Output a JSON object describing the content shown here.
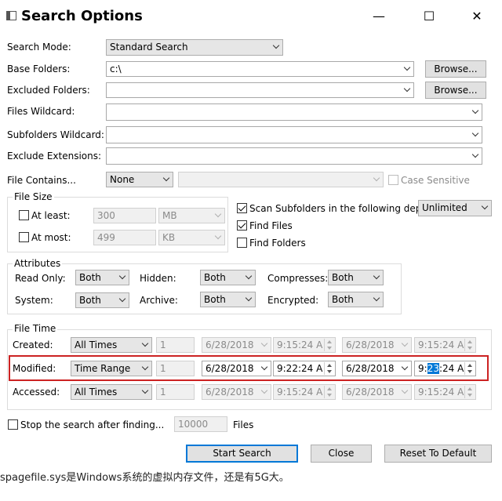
{
  "window": {
    "title": "Search Options",
    "minimize": "—",
    "maximize": "☐",
    "close": "✕"
  },
  "search_mode": {
    "label": "Search Mode:",
    "value": "Standard Search"
  },
  "base_folders": {
    "label": "Base Folders:",
    "value": "c:\\",
    "browse": "Browse..."
  },
  "excluded_folders": {
    "label": "Excluded Folders:",
    "value": "",
    "browse": "Browse..."
  },
  "files_wildcard": {
    "label": "Files Wildcard:",
    "value": ""
  },
  "subfolders_wildcard": {
    "label": "Subfolders Wildcard:",
    "value": ""
  },
  "exclude_extensions": {
    "label": "Exclude Extensions:",
    "value": ""
  },
  "file_contains": {
    "label": "File Contains...",
    "mode": "None",
    "value": "",
    "case_sensitive": "Case Sensitive"
  },
  "file_size": {
    "group": "File Size",
    "at_least": {
      "label": "At least:",
      "value": "300",
      "unit": "MB"
    },
    "at_most": {
      "label": "At most:",
      "value": "499",
      "unit": "KB"
    }
  },
  "scan": {
    "label": "Scan Subfolders in the following depth:",
    "checked": true,
    "depth": "Unlimited"
  },
  "find_files": {
    "label": "Find Files",
    "checked": true
  },
  "find_folders": {
    "label": "Find Folders",
    "checked": false
  },
  "attributes": {
    "group": "Attributes",
    "read_only": {
      "label": "Read Only:",
      "value": "Both"
    },
    "hidden": {
      "label": "Hidden:",
      "value": "Both"
    },
    "compresses": {
      "label": "Compresses:",
      "value": "Both"
    },
    "system": {
      "label": "System:",
      "value": "Both"
    },
    "archive": {
      "label": "Archive:",
      "value": "Both"
    },
    "encrypted": {
      "label": "Encrypted:",
      "value": "Both"
    }
  },
  "file_time": {
    "group": "File Time",
    "rows": [
      {
        "label": "Created:",
        "mode": "All Times",
        "num": "1",
        "date1": "6/28/2018",
        "time1": "9:15:24 A",
        "date2": "6/28/2018",
        "time2": "9:15:24 A"
      },
      {
        "label": "Modified:",
        "mode": "Time Range",
        "num": "1",
        "date1": "6/28/2018",
        "time1": "9:22:24 A",
        "date2": "6/28/2018",
        "time2_pre": "9:",
        "time2_sel": "23",
        "time2_post": ":24 A"
      },
      {
        "label": "Accessed:",
        "mode": "All Times",
        "num": "1",
        "date1": "6/28/2018",
        "time1": "9:15:24 A",
        "date2": "6/28/2018",
        "time2": "9:15:24 A"
      }
    ]
  },
  "stop_search": {
    "label": "Stop the search after finding...",
    "value": "10000",
    "unit": "Files"
  },
  "buttons": {
    "start": "Start Search",
    "close": "Close",
    "reset": "Reset To Default"
  },
  "background_text": "spagefile.sys是Windows系统的虚拟内存文件，还是有5G大。",
  "colors": {
    "accent": "#0078d7",
    "highlight_border": "#cc2222"
  }
}
